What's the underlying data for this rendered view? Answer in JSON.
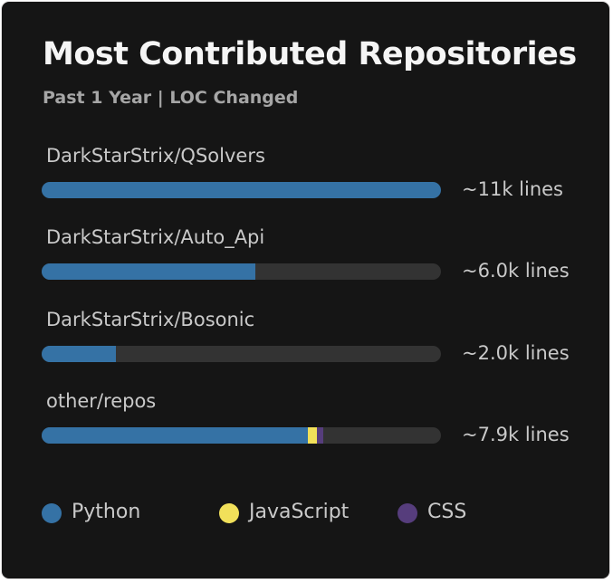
{
  "card": {
    "title": "Most Contributed Repositories",
    "subtitle": "Past 1 Year | LOC Changed"
  },
  "colors": {
    "Python": "#3572a5",
    "JavaScript": "#f1e05a",
    "CSS": "#563d7c"
  },
  "repos": [
    {
      "name": "DarkStarStrix/QSolvers",
      "lines": "~11k lines",
      "segments": [
        {
          "language": "Python",
          "fraction": 1.0
        }
      ]
    },
    {
      "name": "DarkStarStrix/Auto_Api",
      "lines": "~6.0k lines",
      "segments": [
        {
          "language": "Python",
          "fraction": 0.535
        }
      ]
    },
    {
      "name": "DarkStarStrix/Bosonic",
      "lines": "~2.0k lines",
      "segments": [
        {
          "language": "Python",
          "fraction": 0.186
        }
      ]
    },
    {
      "name": "other/repos",
      "lines": "~7.9k lines",
      "segments": [
        {
          "language": "Python",
          "fraction": 0.667
        },
        {
          "language": "JavaScript",
          "fraction": 0.023
        },
        {
          "language": "CSS",
          "fraction": 0.016
        }
      ]
    }
  ],
  "legend": [
    {
      "label": "Python",
      "color": "#3572a5"
    },
    {
      "label": "JavaScript",
      "color": "#f1e05a"
    },
    {
      "label": "CSS",
      "color": "#563d7c"
    }
  ]
}
